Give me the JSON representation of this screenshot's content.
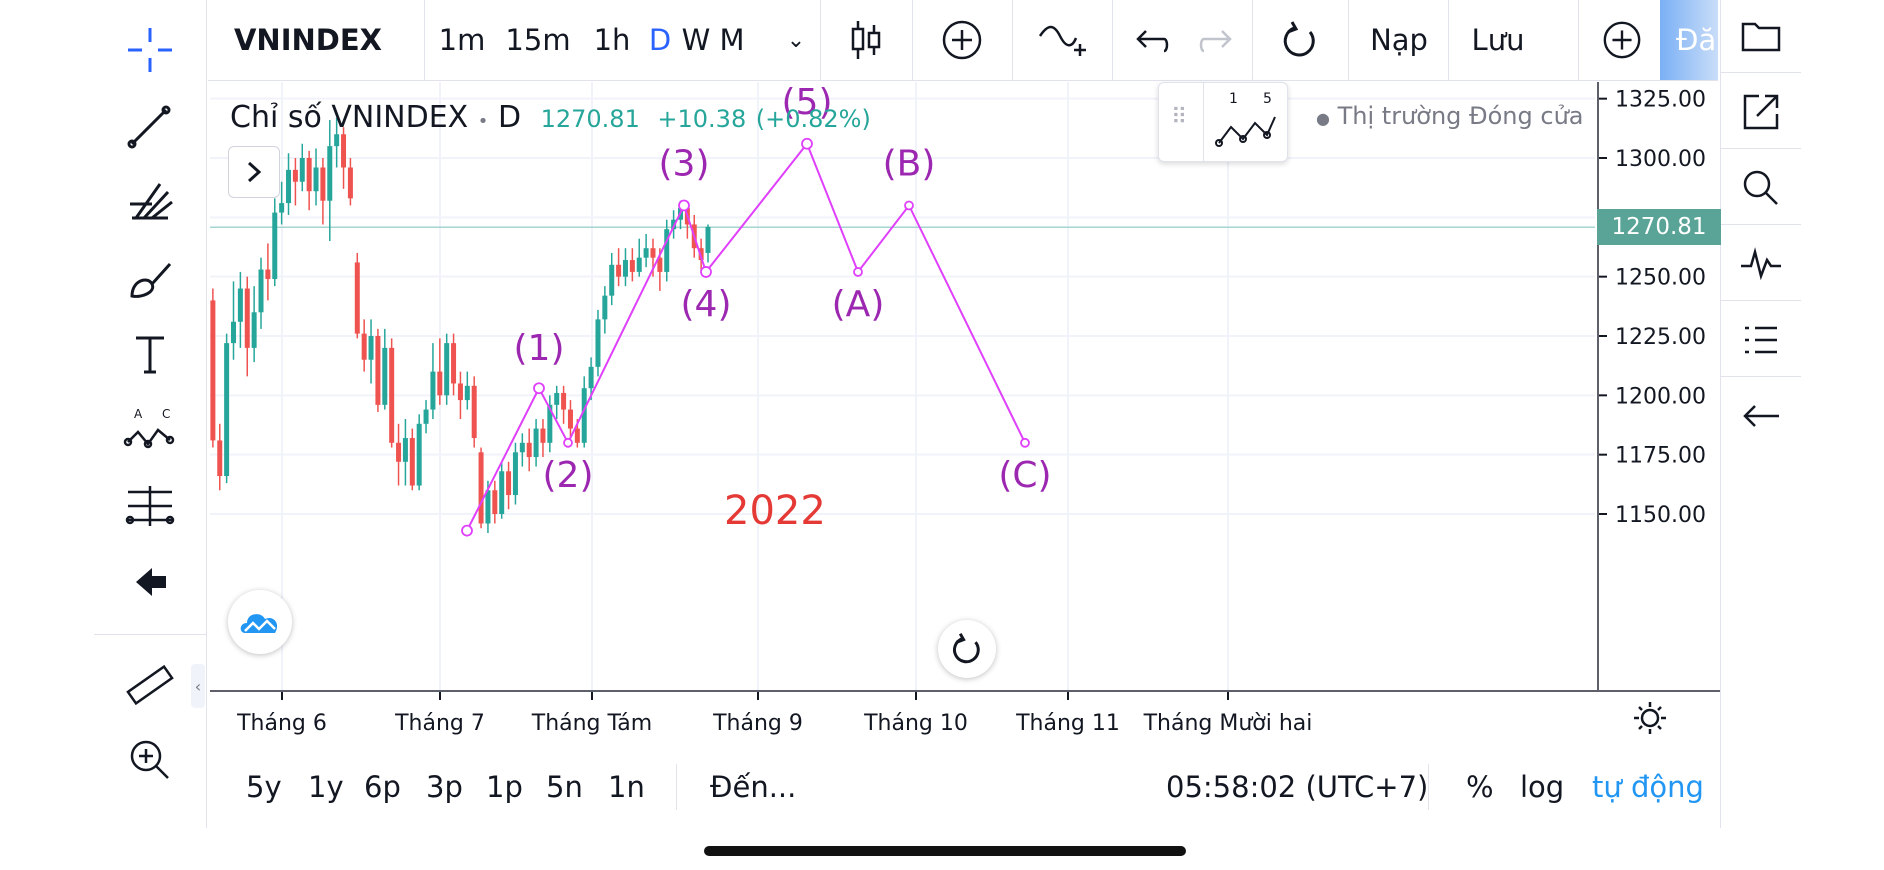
{
  "toolbar": {
    "symbol": "VNINDEX",
    "intervals": [
      "1m",
      "15m",
      "1h",
      "D",
      "W",
      "M"
    ],
    "active_interval": "D",
    "load_label": "Nạp",
    "save_label": "Lưu",
    "publish_label": "Đă"
  },
  "legend": {
    "title": "Chỉ số VNINDEX",
    "interval": "D",
    "last": "1270.81",
    "change": "+10.38",
    "change_pct": "(+0.82%)",
    "market_status": "Thị trường Đóng cửa"
  },
  "wave_widget": {
    "label_start": "1",
    "label_end": "5"
  },
  "price_axis": {
    "ticks": [
      "1325.00",
      "1300.00",
      "1250.00",
      "1225.00",
      "1200.00",
      "1175.00",
      "1150.00"
    ],
    "last_price_label": "1270.81"
  },
  "time_axis": {
    "labels": [
      "Tháng 6",
      "Tháng 7",
      "Tháng Tám",
      "Tháng 9",
      "Tháng 10",
      "Tháng 11",
      "Tháng Mười hai"
    ]
  },
  "annotation_year": "2022",
  "wave_labels": [
    "(1)",
    "(2)",
    "(3)",
    "(4)",
    "(5)",
    "(A)",
    "(B)",
    "(C)"
  ],
  "bottom_bar": {
    "ranges": [
      "5y",
      "1y",
      "6p",
      "3p",
      "1p",
      "5n",
      "1n"
    ],
    "goto_label": "Đến...",
    "clock": "05:58:02 (UTC+7)",
    "percent_label": "%",
    "log_label": "log",
    "auto_label": "tự động"
  },
  "colors": {
    "up": "#26a69a",
    "down": "#ef5350",
    "wave": "#e040fb",
    "wave_label": "#9c27b0",
    "annotation": "#e53935",
    "price_badge": "#5aa497",
    "active_blue": "#2962ff",
    "auto_blue": "#2196f3"
  },
  "chart_data": {
    "type": "candlestick",
    "title": "Chỉ số VNINDEX",
    "ylim": [
      1140,
      1335
    ],
    "candles_note": "approximate daily closes read from chart",
    "candles": [
      {
        "o": 1289,
        "c": 1240,
        "h": 1292,
        "l": 1238
      },
      {
        "o": 1240,
        "c": 1181,
        "h": 1245,
        "l": 1178
      },
      {
        "o": 1181,
        "c": 1166,
        "h": 1188,
        "l": 1160
      },
      {
        "o": 1166,
        "c": 1222,
        "h": 1226,
        "l": 1163
      },
      {
        "o": 1222,
        "c": 1231,
        "h": 1248,
        "l": 1215
      },
      {
        "o": 1231,
        "c": 1245,
        "h": 1252,
        "l": 1220
      },
      {
        "o": 1245,
        "c": 1220,
        "h": 1250,
        "l": 1208
      },
      {
        "o": 1220,
        "c": 1235,
        "h": 1246,
        "l": 1214
      },
      {
        "o": 1235,
        "c": 1253,
        "h": 1258,
        "l": 1228
      },
      {
        "o": 1253,
        "c": 1249,
        "h": 1264,
        "l": 1240
      },
      {
        "o": 1249,
        "c": 1277,
        "h": 1283,
        "l": 1246
      },
      {
        "o": 1277,
        "c": 1281,
        "h": 1290,
        "l": 1272
      },
      {
        "o": 1281,
        "c": 1295,
        "h": 1302,
        "l": 1276
      },
      {
        "o": 1295,
        "c": 1290,
        "h": 1300,
        "l": 1280
      },
      {
        "o": 1290,
        "c": 1300,
        "h": 1306,
        "l": 1286
      },
      {
        "o": 1300,
        "c": 1286,
        "h": 1303,
        "l": 1278
      },
      {
        "o": 1286,
        "c": 1296,
        "h": 1304,
        "l": 1280
      },
      {
        "o": 1296,
        "c": 1282,
        "h": 1300,
        "l": 1272
      },
      {
        "o": 1282,
        "c": 1305,
        "h": 1316,
        "l": 1265
      },
      {
        "o": 1305,
        "c": 1310,
        "h": 1317,
        "l": 1296
      },
      {
        "o": 1310,
        "c": 1296,
        "h": 1313,
        "l": 1287
      },
      {
        "o": 1296,
        "c": 1283,
        "h": 1300,
        "l": 1280
      },
      {
        "o": 1256,
        "c": 1226,
        "h": 1260,
        "l": 1224
      },
      {
        "o": 1226,
        "c": 1215,
        "h": 1232,
        "l": 1210
      },
      {
        "o": 1215,
        "c": 1225,
        "h": 1232,
        "l": 1205
      },
      {
        "o": 1225,
        "c": 1196,
        "h": 1228,
        "l": 1193
      },
      {
        "o": 1196,
        "c": 1220,
        "h": 1228,
        "l": 1194
      },
      {
        "o": 1220,
        "c": 1180,
        "h": 1224,
        "l": 1178
      },
      {
        "o": 1180,
        "c": 1172,
        "h": 1188,
        "l": 1162
      },
      {
        "o": 1172,
        "c": 1182,
        "h": 1190,
        "l": 1162
      },
      {
        "o": 1182,
        "c": 1162,
        "h": 1186,
        "l": 1160
      },
      {
        "o": 1162,
        "c": 1188,
        "h": 1192,
        "l": 1160
      },
      {
        "o": 1188,
        "c": 1194,
        "h": 1198,
        "l": 1184
      },
      {
        "o": 1194,
        "c": 1210,
        "h": 1222,
        "l": 1190
      },
      {
        "o": 1210,
        "c": 1200,
        "h": 1224,
        "l": 1196
      },
      {
        "o": 1200,
        "c": 1222,
        "h": 1226,
        "l": 1196
      },
      {
        "o": 1222,
        "c": 1205,
        "h": 1226,
        "l": 1200
      },
      {
        "o": 1205,
        "c": 1198,
        "h": 1210,
        "l": 1190
      },
      {
        "o": 1198,
        "c": 1204,
        "h": 1210,
        "l": 1194
      },
      {
        "o": 1204,
        "c": 1182,
        "h": 1208,
        "l": 1178
      },
      {
        "o": 1176,
        "c": 1146,
        "h": 1178,
        "l": 1144
      },
      {
        "o": 1146,
        "c": 1160,
        "h": 1164,
        "l": 1142
      },
      {
        "o": 1160,
        "c": 1150,
        "h": 1164,
        "l": 1146
      },
      {
        "o": 1150,
        "c": 1168,
        "h": 1172,
        "l": 1148
      },
      {
        "o": 1168,
        "c": 1158,
        "h": 1172,
        "l": 1152
      },
      {
        "o": 1158,
        "c": 1176,
        "h": 1180,
        "l": 1154
      },
      {
        "o": 1176,
        "c": 1180,
        "h": 1184,
        "l": 1170
      },
      {
        "o": 1180,
        "c": 1174,
        "h": 1186,
        "l": 1168
      },
      {
        "o": 1174,
        "c": 1186,
        "h": 1190,
        "l": 1170
      },
      {
        "o": 1186,
        "c": 1180,
        "h": 1190,
        "l": 1174
      },
      {
        "o": 1180,
        "c": 1196,
        "h": 1200,
        "l": 1176
      },
      {
        "o": 1196,
        "c": 1201,
        "h": 1204,
        "l": 1190
      },
      {
        "o": 1201,
        "c": 1194,
        "h": 1204,
        "l": 1188
      },
      {
        "o": 1194,
        "c": 1186,
        "h": 1198,
        "l": 1182
      },
      {
        "o": 1186,
        "c": 1180,
        "h": 1190,
        "l": 1178
      },
      {
        "o": 1180,
        "c": 1203,
        "h": 1208,
        "l": 1178
      },
      {
        "o": 1203,
        "c": 1212,
        "h": 1216,
        "l": 1198
      },
      {
        "o": 1212,
        "c": 1232,
        "h": 1236,
        "l": 1208
      },
      {
        "o": 1232,
        "c": 1242,
        "h": 1246,
        "l": 1226
      },
      {
        "o": 1242,
        "c": 1255,
        "h": 1260,
        "l": 1238
      },
      {
        "o": 1255,
        "c": 1250,
        "h": 1262,
        "l": 1246
      },
      {
        "o": 1250,
        "c": 1257,
        "h": 1262,
        "l": 1246
      },
      {
        "o": 1257,
        "c": 1252,
        "h": 1262,
        "l": 1248
      },
      {
        "o": 1252,
        "c": 1258,
        "h": 1266,
        "l": 1250
      },
      {
        "o": 1258,
        "c": 1262,
        "h": 1268,
        "l": 1254
      },
      {
        "o": 1262,
        "c": 1258,
        "h": 1266,
        "l": 1250
      },
      {
        "o": 1258,
        "c": 1252,
        "h": 1262,
        "l": 1244
      },
      {
        "o": 1252,
        "c": 1270,
        "h": 1274,
        "l": 1248
      },
      {
        "o": 1270,
        "c": 1274,
        "h": 1278,
        "l": 1266
      },
      {
        "o": 1274,
        "c": 1279,
        "h": 1282,
        "l": 1270
      },
      {
        "o": 1279,
        "c": 1272,
        "h": 1281,
        "l": 1266
      },
      {
        "o": 1272,
        "c": 1262,
        "h": 1276,
        "l": 1258
      },
      {
        "o": 1262,
        "c": 1257,
        "h": 1266,
        "l": 1252
      },
      {
        "o": 1260,
        "c": 1271,
        "h": 1272,
        "l": 1256
      }
    ],
    "elliott_wave": [
      {
        "label": "start",
        "y": 1143
      },
      {
        "label": "(1)",
        "y": 1203
      },
      {
        "label": "(2)",
        "y": 1180
      },
      {
        "label": "(3)",
        "y": 1280
      },
      {
        "label": "(4)",
        "y": 1252
      },
      {
        "label": "(5)",
        "y": 1306
      },
      {
        "label": "(A)",
        "y": 1252
      },
      {
        "label": "(B)",
        "y": 1280
      },
      {
        "label": "(C)",
        "y": 1180
      }
    ]
  }
}
